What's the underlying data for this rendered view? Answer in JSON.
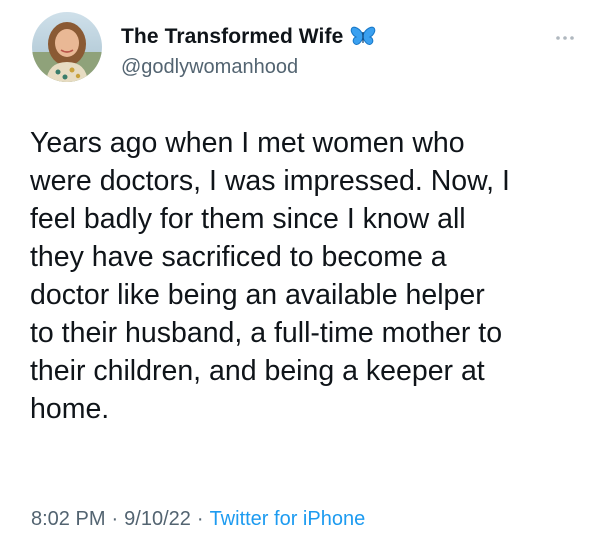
{
  "author": {
    "display_name": "The Transformed Wife",
    "handle": "@godlywomanhood",
    "verified_icon": "butterfly-icon",
    "avatar": "avatar-photo"
  },
  "tweet": {
    "text": "Years ago when I met women who\nwere doctors, I was impressed. Now, I\nfeel badly for them since I know all\nthey have sacrificed to become a\ndoctor like being an available helper\nto their husband, a full-time mother to\ntheir children, and being a keeper at\nhome.",
    "time": "8:02 PM",
    "date": "9/10/22",
    "separator": "·",
    "source": "Twitter for iPhone"
  },
  "icons": {
    "more": "more-icon"
  },
  "colors": {
    "text": "#0f1419",
    "secondary": "#536471",
    "accent": "#1d9bf0"
  }
}
